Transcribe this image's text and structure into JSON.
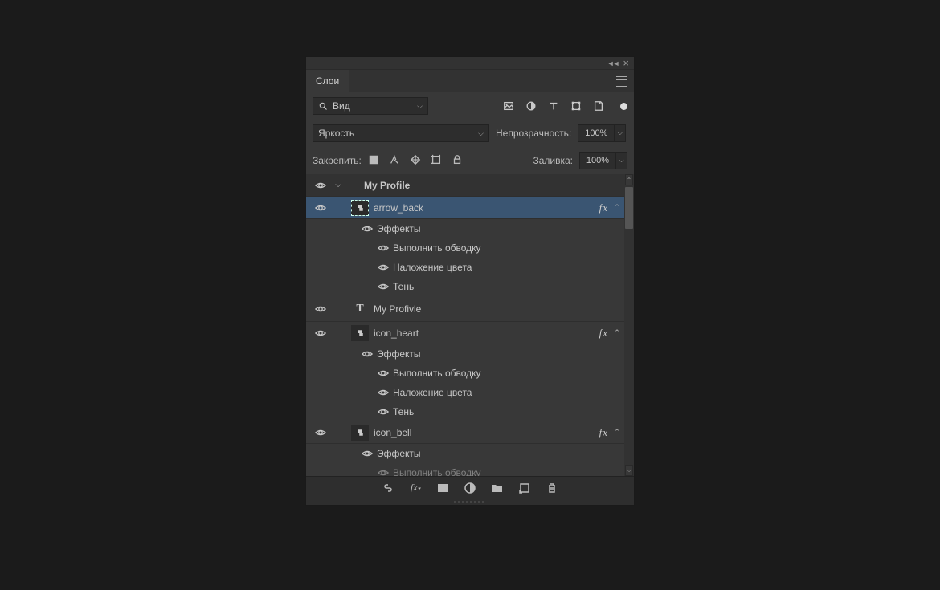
{
  "panel": {
    "tab": "Слои"
  },
  "filters": {
    "view_label": "Вид",
    "blend_mode": "Яркость",
    "opacity_label": "Непрозрачность:",
    "opacity_value": "100%",
    "fill_label": "Заливка:",
    "fill_value": "100%",
    "lock_label": "Закрепить:"
  },
  "layers": {
    "group": "My Profile",
    "arrow_back": "arrow_back",
    "my_profile_text": "My Profivle",
    "icon_heart": "icon_heart",
    "icon_bell": "icon_bell",
    "effects": "Эффекты",
    "stroke": "Выполнить обводку",
    "color_overlay": "Наложение цвета",
    "shadow": "Тень",
    "fx": "fx"
  }
}
